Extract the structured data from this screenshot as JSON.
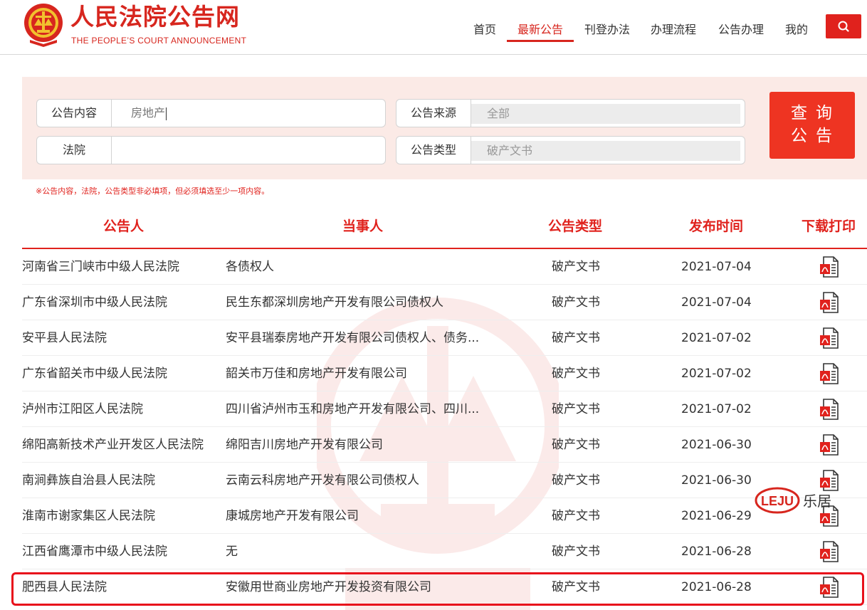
{
  "header": {
    "title": "人民法院公告网",
    "subtitle": "THE PEOPLE’S COURT ANNOUNCEMENT",
    "nav": [
      {
        "label": "首页",
        "active": false
      },
      {
        "label": "最新公告",
        "active": true
      },
      {
        "label": "刊登办法",
        "active": false
      },
      {
        "label": "办理流程",
        "active": false
      },
      {
        "label": "公告办理",
        "active": false
      },
      {
        "label": "我的",
        "active": false
      }
    ],
    "search_icon": "search-icon",
    "accent_color": "#e0221d"
  },
  "filters": {
    "content": {
      "label": "公告内容",
      "value": "房地产"
    },
    "source": {
      "label": "公告来源",
      "value": "全部"
    },
    "court": {
      "label": "法院",
      "value": ""
    },
    "type": {
      "label": "公告类型",
      "value": "破产文书"
    },
    "query_line1": "查询",
    "query_line2": "公告",
    "note": "※公告内容，法院，公告类型非必填项，但必须填选至少一项内容。"
  },
  "table": {
    "headers": [
      "公告人",
      "当事人",
      "公告类型",
      "发布时间",
      "下载打印"
    ],
    "rows": [
      {
        "announcer": "河南省三门峡市中级人民法院",
        "party": "各债权人",
        "type": "破产文书",
        "date": "2021-07-04"
      },
      {
        "announcer": "广东省深圳市中级人民法院",
        "party": "民生东都深圳房地产开发有限公司债权人",
        "type": "破产文书",
        "date": "2021-07-04"
      },
      {
        "announcer": "安平县人民法院",
        "party": "安平县瑞泰房地产开发有限公司债权人、债务...",
        "type": "破产文书",
        "date": "2021-07-02"
      },
      {
        "announcer": "广东省韶关市中级人民法院",
        "party": "韶关市万佳和房地产开发有限公司",
        "type": "破产文书",
        "date": "2021-07-02"
      },
      {
        "announcer": "泸州市江阳区人民法院",
        "party": "四川省泸州市玉和房地产开发有限公司、四川...",
        "type": "破产文书",
        "date": "2021-07-02"
      },
      {
        "announcer": "绵阳高新技术产业开发区人民法院",
        "party": "绵阳吉川房地产开发有限公司",
        "type": "破产文书",
        "date": "2021-06-30"
      },
      {
        "announcer": "南涧彝族自治县人民法院",
        "party": "云南云科房地产开发有限公司债权人",
        "type": "破产文书",
        "date": "2021-06-30"
      },
      {
        "announcer": "淮南市谢家集区人民法院",
        "party": "康城房地产开发有限公司",
        "type": "破产文书",
        "date": "2021-06-29"
      },
      {
        "announcer": "江西省鹰潭市中级人民法院",
        "party": "无",
        "type": "破产文书",
        "date": "2021-06-28"
      },
      {
        "announcer": "肥西县人民法院",
        "party": "安徽用世商业房地产开发投资有限公司",
        "type": "破产文书",
        "date": "2021-06-28"
      }
    ],
    "download_icon": "pdf-icon"
  },
  "watermark": {
    "logo_badge": "LEJU",
    "logo_text": "乐居"
  }
}
